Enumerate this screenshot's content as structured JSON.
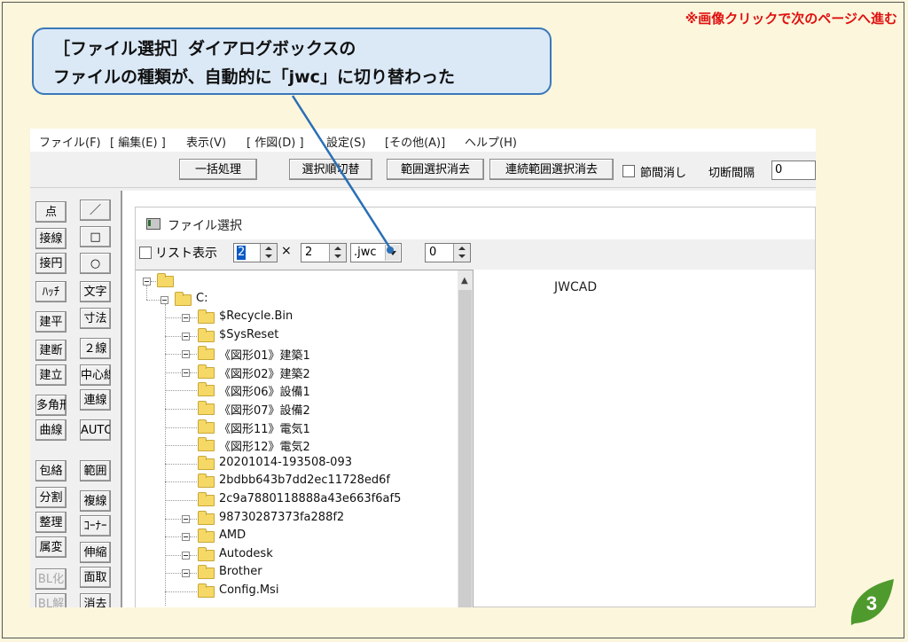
{
  "top_note": "※画像クリックで次のページへ進む",
  "callout": {
    "line1": "［ファイル選択］ダイアログボックスの",
    "line2": "ファイルの種類が、自動的に「jwc」に切り替わった"
  },
  "menu": [
    "ファイル(F)",
    "[ 編集(E) ]",
    "表示(V)",
    "[ 作図(D) ]",
    "設定(S)",
    "[その他(A)]",
    "ヘルプ(H)"
  ],
  "toolbar": {
    "batch": "一括処理",
    "order_toggle": "選択順切替",
    "range_clear": "範囲選択消去",
    "continuous_clear": "連続範囲選択消去",
    "segment_clear": "節間消し",
    "cut_interval": "切断間隔",
    "cut_interval_value": "0"
  },
  "left_tools": {
    "col1": [
      "点",
      "接線",
      "接円",
      "ﾊｯﾁ",
      "建平",
      "建断",
      "建立",
      "多角形",
      "曲線",
      "包絡",
      "分割",
      "整理",
      "属変",
      "BL化",
      "BL解"
    ],
    "col2": [
      "／",
      "□",
      "○",
      "文字",
      "寸法",
      "２線",
      "中心線",
      "連線",
      "AUTO",
      "範囲",
      "複線",
      "ｺｰﾅｰ",
      "伸縮",
      "面取",
      "消去"
    ]
  },
  "dialog": {
    "title": "ファイル選択",
    "list_view_label": "リスト表示",
    "rows_value": "2",
    "times": "×",
    "cols_value": "2",
    "file_type": ".jwc",
    "num_value": "0",
    "preview_label": "JWCAD",
    "tree_root": "C:",
    "folders": [
      {
        "name": "$Recycle.Bin",
        "expandable": true
      },
      {
        "name": "$SysReset",
        "expandable": true
      },
      {
        "name": "《図形01》建築1",
        "expandable": true
      },
      {
        "name": "《図形02》建築2",
        "expandable": true
      },
      {
        "name": "《図形06》設備1",
        "expandable": false
      },
      {
        "name": "《図形07》設備2",
        "expandable": false
      },
      {
        "name": "《図形11》電気1",
        "expandable": false
      },
      {
        "name": "《図形12》電気2",
        "expandable": false
      },
      {
        "name": "20201014-193508-093",
        "expandable": false
      },
      {
        "name": "2bdbb643b7dd2ec11728ed6f",
        "expandable": false
      },
      {
        "name": "2c9a7880118888a43e663f6af5",
        "expandable": false
      },
      {
        "name": "98730287373fa288f2",
        "expandable": true
      },
      {
        "name": "AMD",
        "expandable": true
      },
      {
        "name": "Autodesk",
        "expandable": true
      },
      {
        "name": "Brother",
        "expandable": true
      },
      {
        "name": "Config.Msi",
        "expandable": false
      }
    ]
  },
  "page_number": "3",
  "colors": {
    "accent_red": "#e01010",
    "callout_border": "#3a78b8",
    "badge_green": "#4f9a2c"
  }
}
